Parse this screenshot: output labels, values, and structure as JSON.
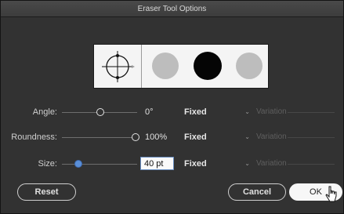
{
  "window": {
    "title": "Eraser Tool Options"
  },
  "rows": {
    "angle": {
      "label": "Angle:",
      "value": "0°",
      "mode": "Fixed",
      "variation": "Variation"
    },
    "roundness": {
      "label": "Roundness:",
      "value": "100%",
      "mode": "Fixed",
      "variation": "Variation"
    },
    "size": {
      "label": "Size:",
      "value": "40 pt",
      "mode": "Fixed",
      "variation": "Variation"
    }
  },
  "buttons": {
    "reset": "Reset",
    "cancel": "Cancel",
    "ok": "OK"
  },
  "icons": {
    "select_chevron": "chevron-down-icon",
    "brush_preview": "crosshair-icon",
    "cursor": "pointer-cursor-icon"
  },
  "colors": {
    "dialog_bg": "#323232",
    "slider_thumb_active": "#5a8fd8",
    "preview_light": "#bdbdbd",
    "preview_dark": "#050505"
  }
}
